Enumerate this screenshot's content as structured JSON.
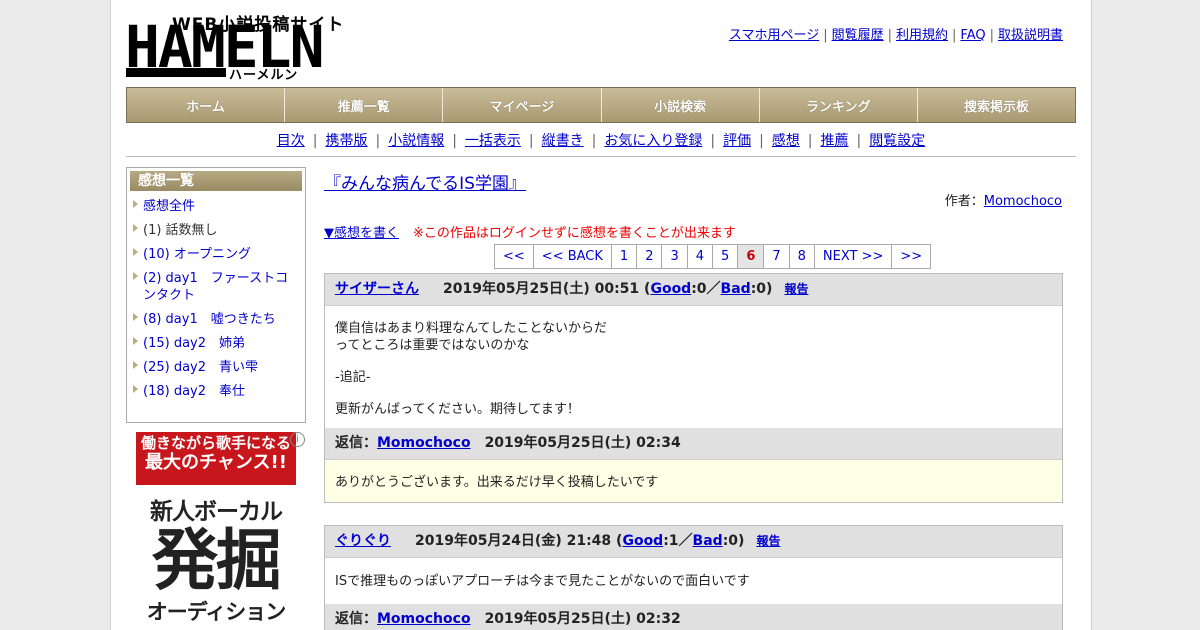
{
  "logo": {
    "web_text": "WEB小説投稿サイト",
    "main_text": "HAMELN",
    "kana_text": "ハーメルン"
  },
  "top_links": [
    "スマホ用ページ",
    "閲覧履歴",
    "利用規約",
    "FAQ",
    "取扱説明書"
  ],
  "global_nav": [
    "ホーム",
    "推薦一覧",
    "マイページ",
    "小説検索",
    "ランキング",
    "捜索掲示板"
  ],
  "sub_nav": [
    "目次",
    "携帯版",
    "小説情報",
    "一括表示",
    "縦書き",
    "お気に入り登録",
    "評価",
    "感想",
    "推薦",
    "閲覧設定"
  ],
  "sidebar": {
    "heading": "感想一覧",
    "items": [
      {
        "label": "感想全件",
        "link": true
      },
      {
        "label": "(1) 話数無し",
        "link": false
      },
      {
        "label": "(10) オープニング",
        "link": true
      },
      {
        "label": "(2) day1　ファーストコンタクト",
        "link": true
      },
      {
        "label": "(8) day1　嘘つきたち",
        "link": true
      },
      {
        "label": "(15) day2　姉弟",
        "link": true
      },
      {
        "label": "(25) day2　青い雫",
        "link": true
      },
      {
        "label": "(18) day2　奉仕",
        "link": true
      }
    ]
  },
  "ad": {
    "line1": "働きながら歌手になる",
    "line2": "最大のチャンス!!",
    "line3": "新人ボーカル",
    "line4": "発掘",
    "line5": "オーディション",
    "info": "i"
  },
  "main": {
    "title": "『みんな病んでるIS学園』",
    "author_label": "作者：",
    "author": "Momochoco",
    "write_link": "▼感想を書く",
    "warning": "※この作品はログインせずに感想を書くことが出来ます",
    "pager": [
      "<<",
      "<< BACK",
      "1",
      "2",
      "3",
      "4",
      "5",
      "6",
      "7",
      "8",
      "NEXT >>",
      ">>"
    ],
    "pager_current": "6"
  },
  "comments": [
    {
      "user": "サイザーさん",
      "date": "2019年05月25日(土) 00:51",
      "good_label": "Good",
      "good": ":0",
      "bad_label": "Bad",
      "bad": ":0",
      "report": "報告",
      "body": [
        "僕自信はあまり料理なんてしたことないからだ\nってところは重要ではないのかな",
        "-追記-",
        "更新がんばってください。期待してます！"
      ],
      "reply_label": "返信：",
      "reply_user": "Momochoco",
      "reply_date": "2019年05月25日(土) 02:34",
      "reply_body": "ありがとうございます。出来るだけ早く投稿したいです"
    },
    {
      "user": "ぐりぐり",
      "date": "2019年05月24日(金) 21:48",
      "good_label": "Good",
      "good": ":1",
      "bad_label": "Bad",
      "bad": ":0",
      "report": "報告",
      "body": [
        "ISで推理ものっぽいアプローチは今まで見たことがないので面白いです"
      ],
      "reply_label": "返信：",
      "reply_user": "Momochoco",
      "reply_date": "2019年05月25日(土) 02:32"
    }
  ]
}
